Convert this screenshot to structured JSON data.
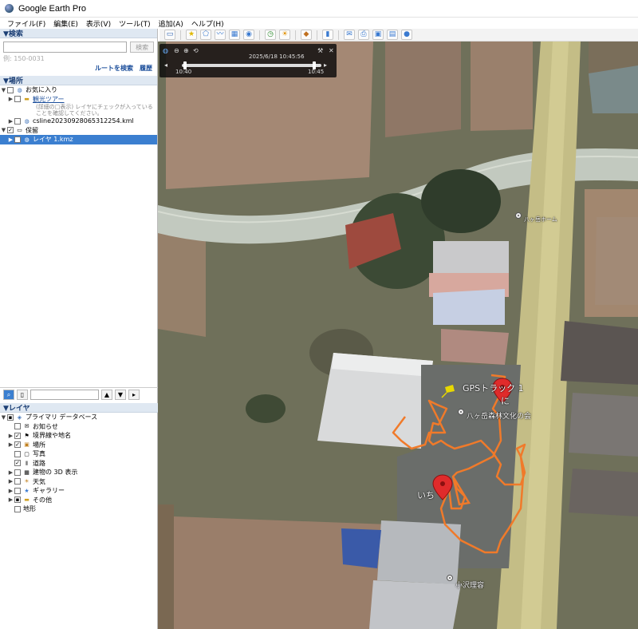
{
  "app": {
    "title": "Google Earth Pro"
  },
  "menu": [
    "ファイル(F)",
    "編集(E)",
    "表示(V)",
    "ツール(T)",
    "追加(A)",
    "ヘルプ(H)"
  ],
  "search": {
    "header": "▼検索",
    "placeholder": "",
    "button": "検索",
    "example": "例: 150-0031",
    "route_link": "ルートを検索",
    "history_link": "履歴"
  },
  "places": {
    "header": "▼場所",
    "favorites": "お気に入り",
    "tour": "観光ツアー",
    "tour_desc": "(詳細の□表示) レイヤにチェックが入っていることを確認してください。",
    "kml": "csline20230928065312254.kml",
    "temp": "保留",
    "layer_file": "レイヤ 1.kmz"
  },
  "layers": {
    "header": "▼レイヤ",
    "items": [
      "プライマリ データベース",
      "お知らせ",
      "境界線や地名",
      "場所",
      "写真",
      "道路",
      "建物の 3D 表示",
      "天気",
      "ギャラリー",
      "その他",
      "地形"
    ]
  },
  "timeslider": {
    "date": "2025/6/18  10:45:56",
    "start": "10:40",
    "end": "10:45"
  },
  "map_labels": {
    "gps_track": "GPSトラック 1",
    "ni": "に",
    "ichi": "いち",
    "culture_hall": "八ヶ岳森林文化の会",
    "shop": "小沢理容",
    "top_poi": "八ヶ岳ホーム"
  },
  "colors": {
    "accent": "#3b7fd0",
    "track": "#f07a2a",
    "marker": "#e02b2b"
  }
}
